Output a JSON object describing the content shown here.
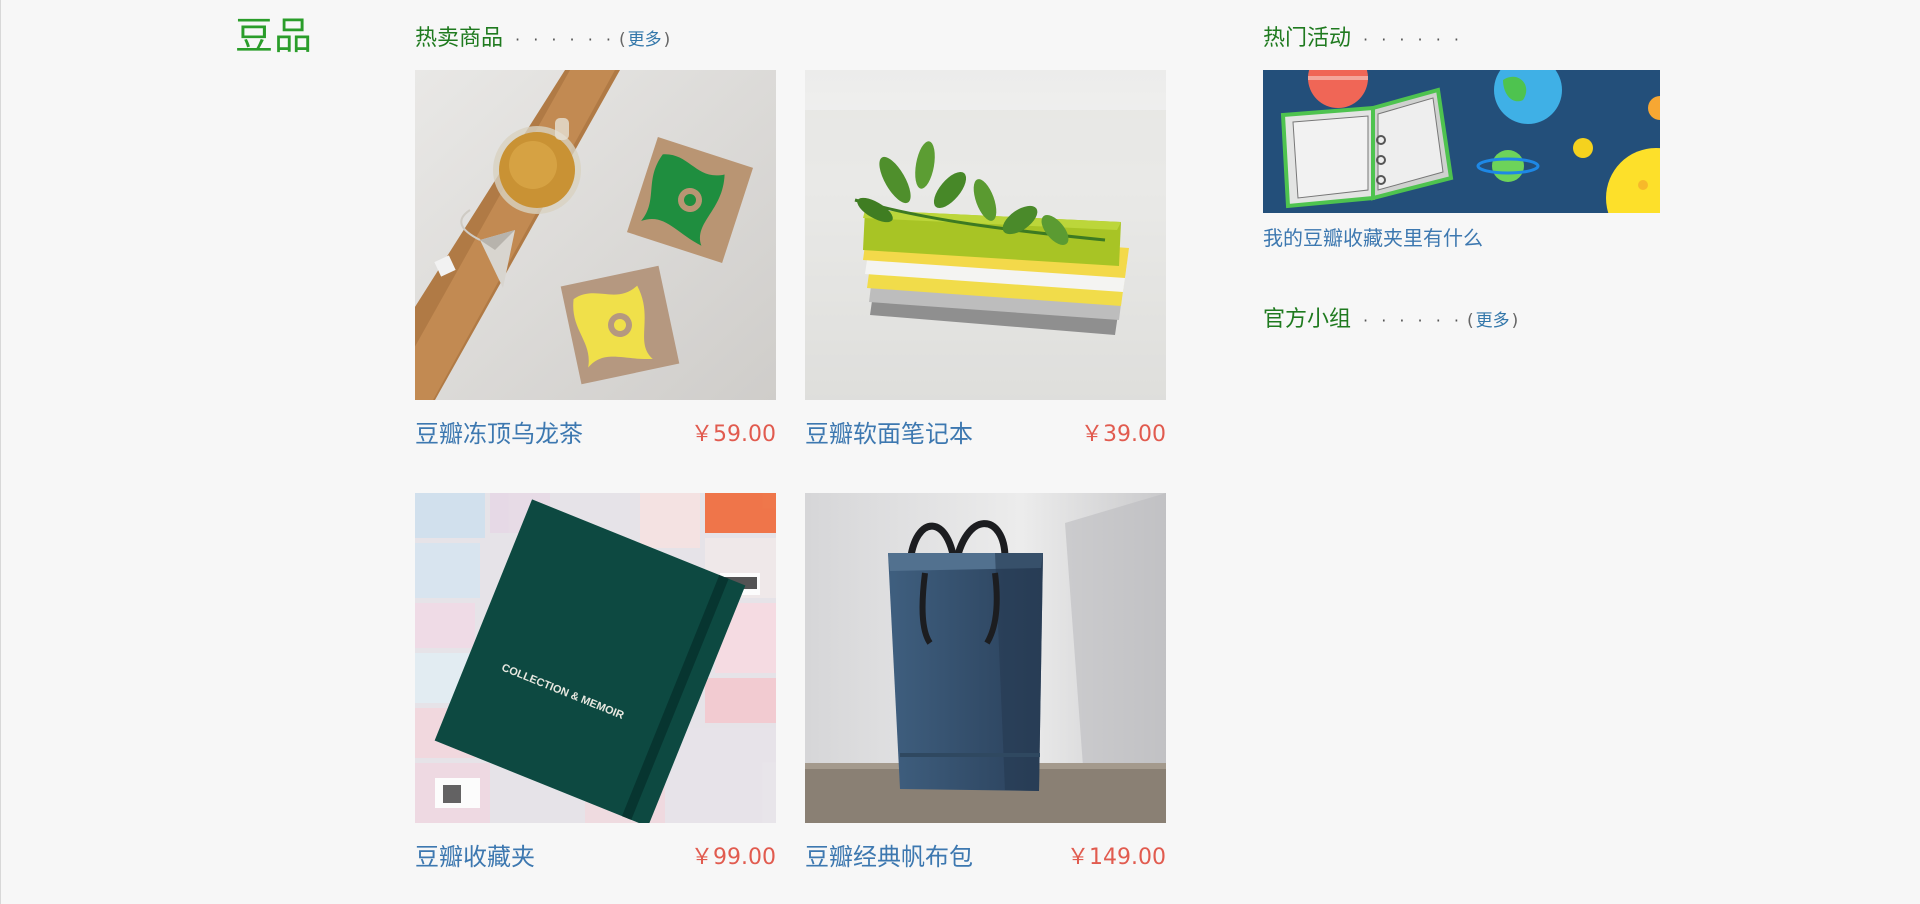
{
  "page": {
    "title": "豆品"
  },
  "hot_goods": {
    "title": "热卖商品",
    "dots": "· · · · · ·",
    "more_open": "(",
    "more_label": "更多",
    "more_close": ")"
  },
  "products": [
    {
      "name": "豆瓣冻顶乌龙茶",
      "price": "￥59.00",
      "image": "oolong-tea-photo"
    },
    {
      "name": "豆瓣软面笔记本",
      "price": "￥39.00",
      "image": "softcover-notebooks-photo"
    },
    {
      "name": "豆瓣收藏夹",
      "price": "￥99.00",
      "image": "collection-binder-photo"
    },
    {
      "name": "豆瓣经典帆布包",
      "price": "￥149.00",
      "image": "canvas-tote-photo"
    }
  ],
  "hot_events": {
    "title": "热门活动",
    "dots": "· · · · · ·",
    "banner_image": "binder-planets-illustration",
    "caption": "我的豆瓣收藏夹里有什么"
  },
  "groups": {
    "title": "官方小组",
    "dots": "· · · · · ·",
    "more_open": "(",
    "more_label": "更多",
    "more_close": ")"
  },
  "colors": {
    "background": "#f7f7f7",
    "title_green": "#2a9d2a",
    "section_green": "#1f7a1f",
    "link_blue": "#3d78b0",
    "price_red": "#e15b4f"
  }
}
